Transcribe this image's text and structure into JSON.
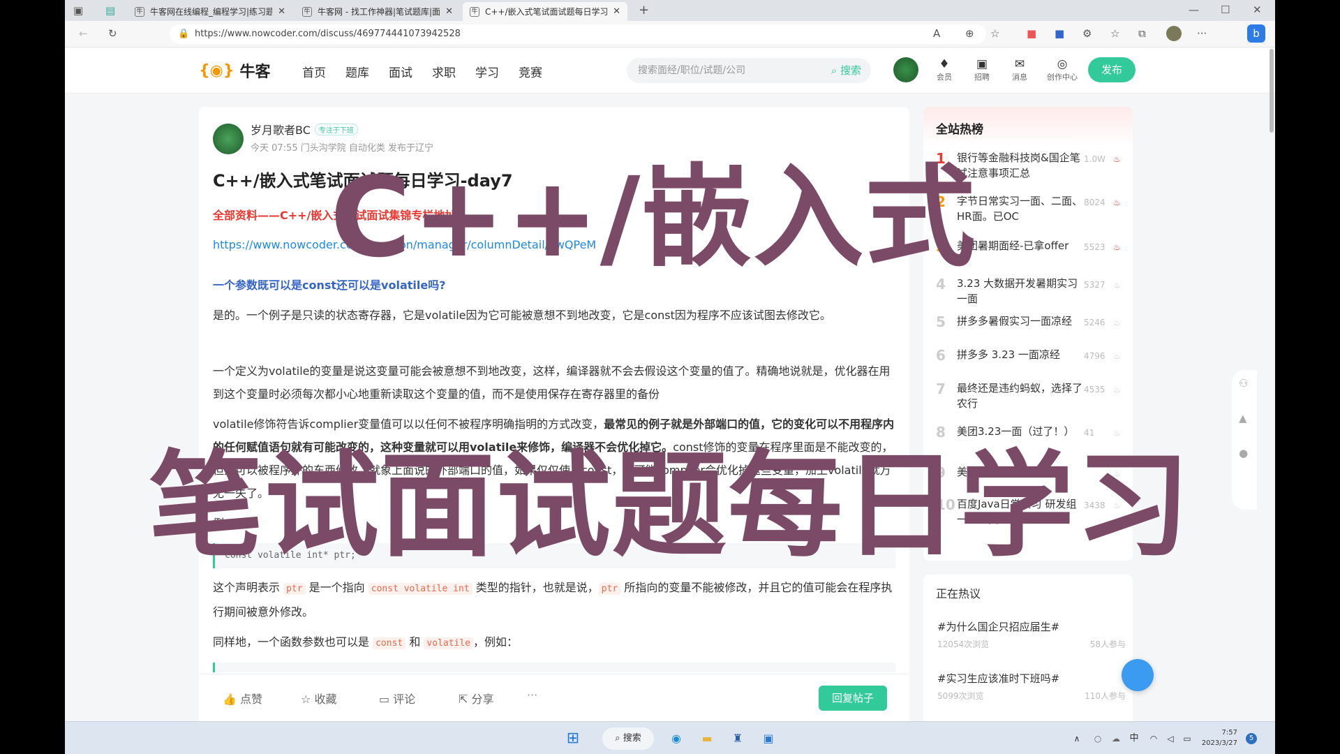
{
  "browser": {
    "tabs": [
      {
        "label": "牛客网在线编程_编程学习|练习题",
        "active": false
      },
      {
        "label": "牛客网 - 找工作神器|笔试题库|面",
        "active": false
      },
      {
        "label": "C++/嵌入式笔试面试题每日学习",
        "active": true
      }
    ],
    "new_tab": "+",
    "url": "https://www.nowcoder.com/discuss/469774441073942528"
  },
  "site": {
    "logo": "牛客",
    "nav": [
      "首页",
      "题库",
      "面试",
      "求职",
      "学习",
      "竞赛"
    ],
    "search_placeholder": "搜索面经/职位/试题/公司",
    "search_btn": "搜索",
    "header_icons": [
      {
        "label": "会员",
        "icon": "diamond-icon"
      },
      {
        "label": "招聘",
        "icon": "briefcase-icon"
      },
      {
        "label": "消息",
        "icon": "mail-icon"
      },
      {
        "label": "创作中心",
        "icon": "bulb-icon"
      }
    ],
    "publish": "发布",
    "accent": "#32ca99"
  },
  "post": {
    "author": "岁月歌者BC",
    "badge": "专注于下班",
    "meta": "今天 07:55 门头沟学院 自动化类 发布于辽宁",
    "title": "C++/嵌入式笔试面试题每日学习-day7",
    "red_link": "全部资料——C++/嵌入式笔试面试集锦专栏地址",
    "url": "https://www.nowcoder.com/creation/manager/columnDetail/awQPeM",
    "question": "一个参数既可以是const还可以是volatile吗?",
    "para1": "是的。一个例子是只读的状态寄存器，它是volatile因为它可能被意想不到地改变，它是const因为程序不应该试图去修改它。",
    "para2": "一个定义为volatile的变量是说这变量可能会被意想不到地改变，这样，编译器就不会去假设这个变量的值了。精确地说就是，优化器在用到这个变量时必须每次都小心地重新读取这个变量的值，而不是使用保存在寄存器里的备份",
    "para3a": "volatile修饰符告诉complier变量值可以以任何不被程序明确指明的方式改变，",
    "para3b": "最常见的例子就是外部端口的值，它的变化可以不用程序内的任何赋值语句就有可能改变的，这种变量就可以用volatile来修饰，编译器不会优化掉它。",
    "para3c": "const修饰的变量在程序里面是不能改变的，但是可以被程序外的东西修改，就象上面说的外部端口的值，如果仅仅使用const，有可能complier会优化掉这些变量，加上volatile就万无一失了。",
    "example_label": "例：",
    "code1": "const volatile int* ptr;",
    "decl_a": "这个声明表示 ",
    "decl_code1": "ptr",
    "decl_b": " 是一个指向 ",
    "decl_code2": "const volatile int",
    "decl_c": " 类型的指针，也就是说，",
    "decl_code3": "ptr",
    "decl_d": " 所指向的变量不能被修改，并且它的值可能会在程序执行期间被意外修改。",
    "same_a": "同样地，一个函数参数也可以是 ",
    "same_code1": "const",
    "same_b": " 和 ",
    "same_code2": "volatile",
    "same_c": "，例如：",
    "actions": [
      "点赞",
      "收藏",
      "评论",
      "分享",
      "···"
    ],
    "reply": "回复帖子"
  },
  "hot": {
    "title": "全站热榜",
    "items": [
      {
        "rank": "1",
        "title": "银行等金融科技岗&国企笔试注意事项汇总",
        "count": "1.0W"
      },
      {
        "rank": "2",
        "title": "字节日常实习一面、二面、HR面。已OC",
        "count": "8024"
      },
      {
        "rank": "3",
        "title": "美团暑期面经-已拿offer",
        "count": "5523"
      },
      {
        "rank": "4",
        "title": "3.23 大数据开发暑期实习一面",
        "count": "5327"
      },
      {
        "rank": "5",
        "title": "拼多多暑假实习一面凉经",
        "count": "5246"
      },
      {
        "rank": "6",
        "title": "拼多多 3.23 一面凉经",
        "count": "4796"
      },
      {
        "rank": "7",
        "title": "最终还是违约蚂蚁，选择了农行",
        "count": "4535"
      },
      {
        "rank": "8",
        "title": "美团3.23一面（过了！）",
        "count": "41"
      },
      {
        "rank": "9",
        "title": "美团一面+二面",
        "count": ""
      },
      {
        "rank": "10",
        "title": "百度Java日常实习 研发组 一二三面",
        "count": "3438"
      }
    ]
  },
  "topics": {
    "title": "正在热议",
    "items": [
      {
        "tag": "#为什么国企只招应届生#",
        "views": "12054次浏览",
        "joined": "58人参与"
      },
      {
        "tag": "#实习生应该准时下班吗#",
        "views": "5099次浏览",
        "joined": "110人参与"
      }
    ]
  },
  "overlay": {
    "line1": "C++/嵌入式",
    "line2": "笔试面试题每日学习",
    "color": "#7b4a66"
  },
  "taskbar": {
    "search": "搜索",
    "ime": "中",
    "time": "7:57",
    "date": "2023/3/27",
    "badge": "5"
  }
}
